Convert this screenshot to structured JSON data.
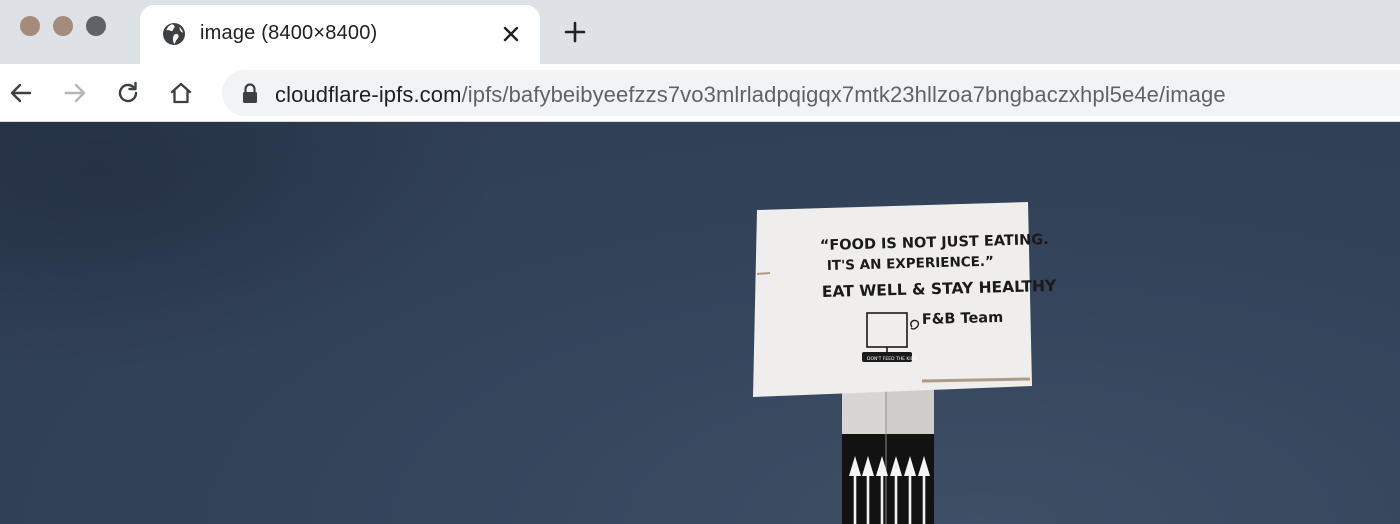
{
  "window": {
    "traffic_lights": [
      "close",
      "minimize",
      "maximize"
    ]
  },
  "tab": {
    "icon": "globe-icon",
    "title": "image (8400×8400)",
    "close_icon": "close-icon"
  },
  "new_tab_icon": "plus-icon",
  "toolbar": {
    "back_icon": "arrow-left-icon",
    "forward_icon": "arrow-right-icon",
    "reload_icon": "reload-icon",
    "home_icon": "home-icon"
  },
  "address": {
    "lock_icon": "lock-icon",
    "host": "cloudflare-ipfs.com",
    "path": "/ipfs/bafybeibyeefzzs7vo3mlrladpqigqx7mtk23hllzoa7bngbaczxhpl5e4e/image"
  },
  "sign": {
    "quote_line1": "“FOOD IS NOT JUST EATING.",
    "quote_line2": "IT'S AN EXPERIENCE.”",
    "line3": "EAT WELL & STAY HEALTHY",
    "signature": "F&B Team",
    "monitor_caption": "DON'T FEED THE KIDS"
  },
  "colors": {
    "sky": "#2f3f55",
    "tabstrip": "#dee1e6",
    "omnibox": "#f1f3f4"
  }
}
